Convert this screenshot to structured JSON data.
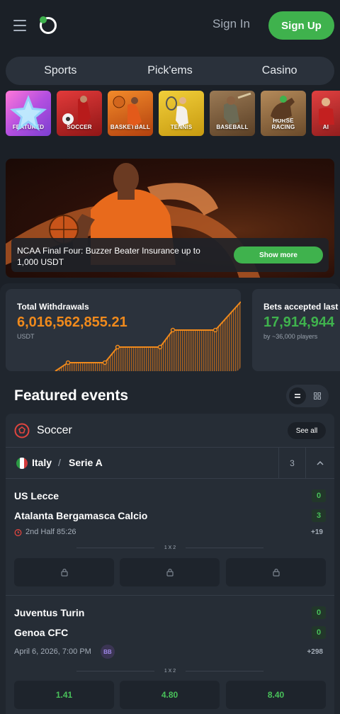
{
  "header": {
    "sign_in": "Sign In",
    "sign_up": "Sign Up",
    "accent": "#3fb24d"
  },
  "nav": {
    "items": [
      {
        "label": "Sports"
      },
      {
        "label": "Pick'ems"
      },
      {
        "label": "Casino"
      }
    ]
  },
  "categories": [
    {
      "label": "FEATURED"
    },
    {
      "label": "SOCCER"
    },
    {
      "label": "BASKETBALL"
    },
    {
      "label": "TENNIS"
    },
    {
      "label": "BASEBALL"
    },
    {
      "label": "HORSE RACING"
    },
    {
      "label": "AI"
    }
  ],
  "banner": {
    "text": "NCAA Final Four: Buzzer Beater Insurance up to 1,000 USDT",
    "button": "Show more"
  },
  "stats": [
    {
      "title": "Total Withdrawals",
      "value": "6,016,562,855.21",
      "sub": "USDT",
      "color": "#f08a1c"
    },
    {
      "title": "Bets accepted last",
      "value": "17,914,944",
      "sub": "by ~36,000 players",
      "color": "#3fb24d"
    }
  ],
  "featured": {
    "title": "Featured events",
    "sport": "Soccer",
    "see_all": "See all",
    "league": {
      "country": "Italy",
      "separator": "/",
      "name": "Serie A",
      "count": "3"
    },
    "matches": [
      {
        "home": "US Lecce",
        "away": "Atalanta Bergamasca Calcio",
        "home_score": "0",
        "away_score": "3",
        "status": "2nd Half 85:26",
        "more": "+19",
        "market": "1 X 2",
        "odds": [
          "",
          "",
          ""
        ],
        "locked": true
      },
      {
        "home": "Juventus Turin",
        "away": "Genoa CFC",
        "home_score": "0",
        "away_score": "0",
        "status": "April 6, 2026, 7:00 PM",
        "badge": "BB",
        "more": "+298",
        "market": "1 X 2",
        "odds": [
          "1.41",
          "4.80",
          "8.40"
        ],
        "locked": false
      }
    ]
  }
}
